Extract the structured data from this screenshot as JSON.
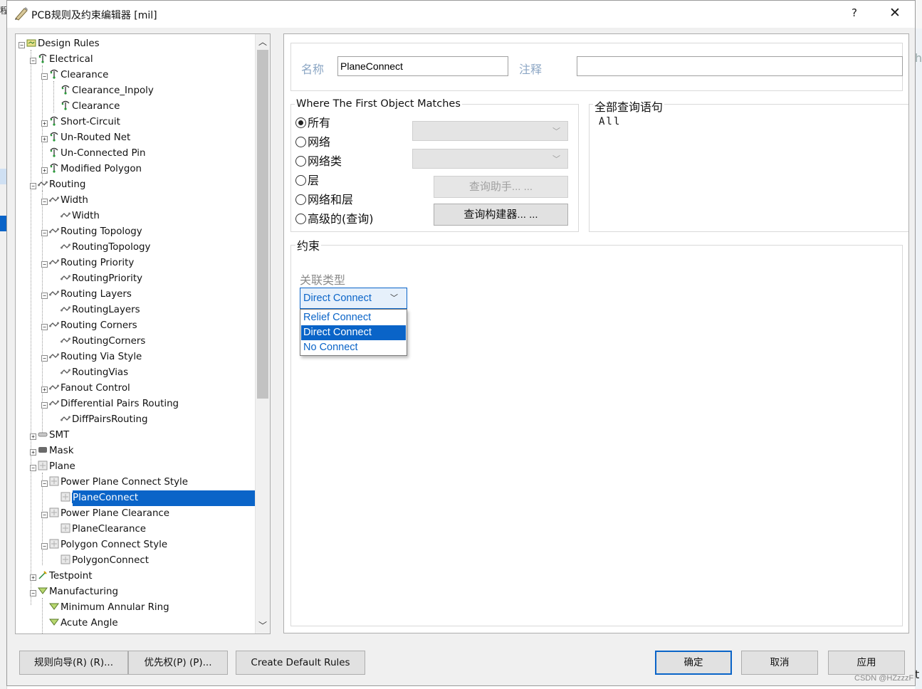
{
  "window": {
    "title": "PCB规则及约束编辑器 [mil]",
    "help": "?",
    "close": "✕"
  },
  "background": {
    "left_char": "程",
    "right_char_top": "h",
    "right_char_bottom": "t"
  },
  "tree": {
    "nodes": [
      {
        "label": "Design Rules",
        "icon": "design-rules-icon",
        "expander": "minus"
      },
      {
        "label": "Electrical",
        "icon": "electrical-rule-icon",
        "expander": "minus"
      },
      {
        "label": "Clearance",
        "icon": "electrical-rule-icon",
        "expander": "minus"
      },
      {
        "label": "Clearance_Inpoly",
        "icon": "electrical-rule-icon",
        "expander": ""
      },
      {
        "label": "Clearance",
        "icon": "electrical-rule-icon",
        "expander": ""
      },
      {
        "label": "Short-Circuit",
        "icon": "electrical-rule-icon",
        "expander": "plus"
      },
      {
        "label": "Un-Routed Net",
        "icon": "electrical-rule-icon",
        "expander": "plus"
      },
      {
        "label": "Un-Connected Pin",
        "icon": "electrical-rule-icon",
        "expander": ""
      },
      {
        "label": "Modified Polygon",
        "icon": "electrical-rule-icon",
        "expander": "plus"
      },
      {
        "label": "Routing",
        "icon": "routing-rule-icon",
        "expander": "minus"
      },
      {
        "label": "Width",
        "icon": "routing-rule-icon",
        "expander": "minus"
      },
      {
        "label": "Width",
        "icon": "routing-rule-icon",
        "expander": ""
      },
      {
        "label": "Routing Topology",
        "icon": "routing-rule-icon",
        "expander": "minus"
      },
      {
        "label": "RoutingTopology",
        "icon": "routing-rule-icon",
        "expander": ""
      },
      {
        "label": "Routing Priority",
        "icon": "routing-rule-icon",
        "expander": "minus"
      },
      {
        "label": "RoutingPriority",
        "icon": "routing-rule-icon",
        "expander": ""
      },
      {
        "label": "Routing Layers",
        "icon": "routing-rule-icon",
        "expander": "minus"
      },
      {
        "label": "RoutingLayers",
        "icon": "routing-rule-icon",
        "expander": ""
      },
      {
        "label": "Routing Corners",
        "icon": "routing-rule-icon",
        "expander": "minus"
      },
      {
        "label": "RoutingCorners",
        "icon": "routing-rule-icon",
        "expander": ""
      },
      {
        "label": "Routing Via Style",
        "icon": "routing-rule-icon",
        "expander": "minus"
      },
      {
        "label": "RoutingVias",
        "icon": "routing-rule-icon",
        "expander": ""
      },
      {
        "label": "Fanout Control",
        "icon": "routing-rule-icon",
        "expander": "plus"
      },
      {
        "label": "Differential Pairs Routing",
        "icon": "routing-rule-icon",
        "expander": "minus"
      },
      {
        "label": "DiffPairsRouting",
        "icon": "routing-rule-icon",
        "expander": ""
      },
      {
        "label": "SMT",
        "icon": "smt-rule-icon",
        "expander": "plus"
      },
      {
        "label": "Mask",
        "icon": "mask-rule-icon",
        "expander": "plus"
      },
      {
        "label": "Plane",
        "icon": "plane-rule-icon",
        "expander": "minus"
      },
      {
        "label": "Power Plane Connect Style",
        "icon": "plane-rule-icon",
        "expander": "minus"
      },
      {
        "label": "PlaneConnect",
        "icon": "plane-rule-icon",
        "expander": "",
        "selected": true
      },
      {
        "label": "Power Plane Clearance",
        "icon": "plane-rule-icon",
        "expander": "minus"
      },
      {
        "label": "PlaneClearance",
        "icon": "plane-rule-icon",
        "expander": ""
      },
      {
        "label": "Polygon Connect Style",
        "icon": "plane-rule-icon",
        "expander": "minus"
      },
      {
        "label": "PolygonConnect",
        "icon": "plane-rule-icon",
        "expander": ""
      },
      {
        "label": "Testpoint",
        "icon": "testpoint-rule-icon",
        "expander": "plus"
      },
      {
        "label": "Manufacturing",
        "icon": "manufacturing-rule-icon",
        "expander": "minus"
      },
      {
        "label": "Minimum Annular Ring",
        "icon": "manufacturing-rule-icon",
        "expander": ""
      },
      {
        "label": "Acute Angle",
        "icon": "manufacturing-rule-icon",
        "expander": ""
      }
    ],
    "scroll_up": "︿",
    "scroll_down": "﹀"
  },
  "rule": {
    "name_label": "名称",
    "name_value": "PlaneConnect",
    "comment_label": "注释",
    "comment_value": ""
  },
  "first_object": {
    "title": "Where The First Object Matches",
    "options": [
      "所有",
      "网络",
      "网络类",
      "层",
      "网络和层",
      "高级的(查询)"
    ],
    "selected_index": 0,
    "query_helper_label": "查询助手... ...",
    "query_builder_label": "查询构建器... ..."
  },
  "full_query": {
    "title": "全部查询语句",
    "text": "All"
  },
  "constraints": {
    "title": "约束",
    "connect_type_label": "关联类型",
    "connect_type_value": "Direct Connect",
    "options": [
      "Relief Connect",
      "Direct Connect",
      "No Connect"
    ],
    "selected_option_index": 1
  },
  "buttons": {
    "rule_wizard": "规则向导(R) (R)...",
    "priorities": "优先权(P) (P)...",
    "create_default_rules": "Create Default Rules",
    "ok": "确定",
    "cancel": "取消",
    "apply": "应用"
  },
  "watermark": "CSDN @HZzzzF",
  "colors": {
    "accent": "#0a64c8",
    "label_grey_blue": "#8ba6c4"
  }
}
